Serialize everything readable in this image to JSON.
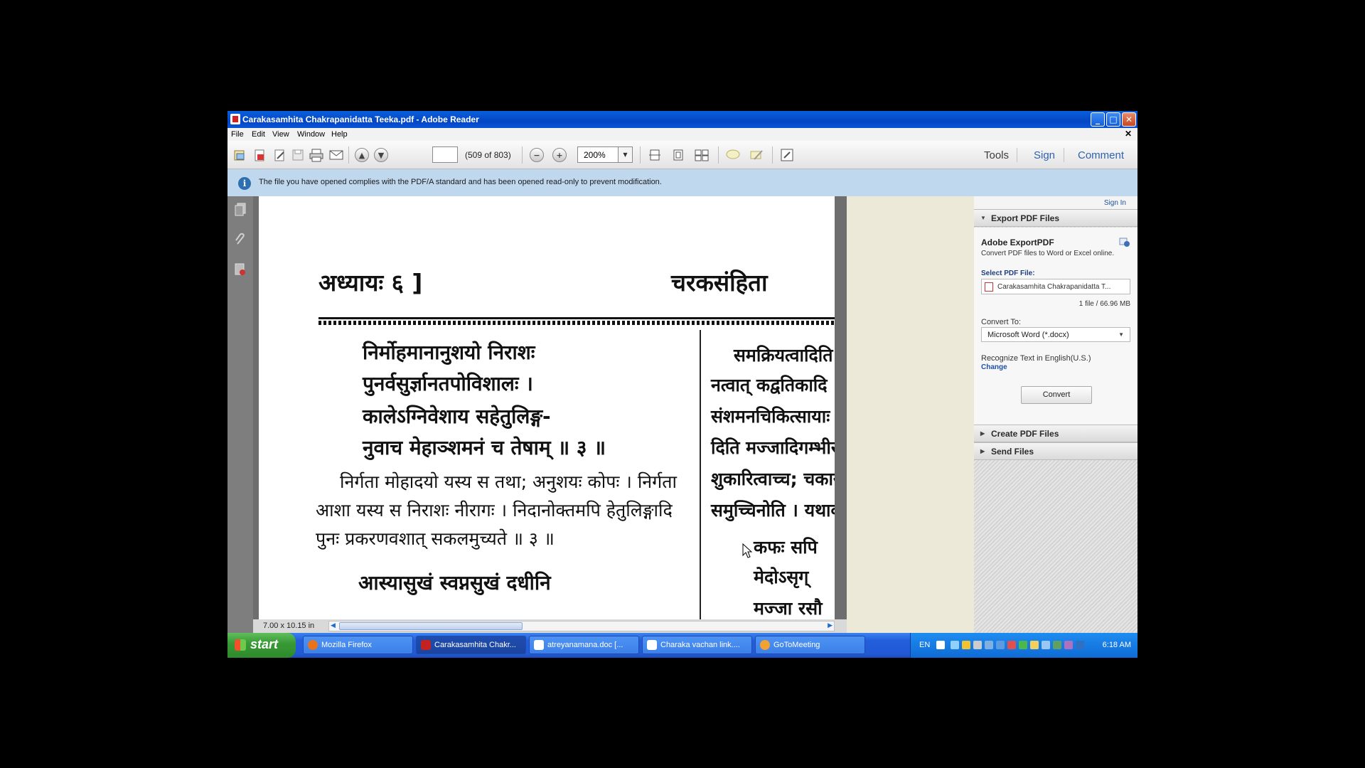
{
  "window": {
    "title": "Carakasamhita Chakrapanidatta Teeka.pdf - Adobe Reader",
    "minimize": "_",
    "maximize": "□",
    "close": "✕"
  },
  "menu": {
    "items": [
      "File",
      "Edit",
      "View",
      "Window",
      "Help"
    ],
    "doc_close": "✕"
  },
  "toolbar": {
    "page_input_value": "",
    "page_count": "(509 of 803)",
    "zoom": "200%",
    "tools_label": "Tools",
    "sign_label": "Sign",
    "comment_label": "Comment"
  },
  "infobar": {
    "icon": "i",
    "text": "The file you have opened complies with the PDF/A standard and has been opened read-only to prevent modification."
  },
  "document": {
    "header_left": "अध्यायः ६ ]",
    "header_right": "चरकसंहिता",
    "verse_lines": [
      "निर्मोहमानानुशयो निराशः",
      "पुनर्वसुर्ज्ञानतपोविशालः ।",
      "कालेऽग्निवेशाय सहेतुलिङ्ग-",
      "नुवाच मेहाञ्शमनं च तेषाम् ॥ ३ ॥"
    ],
    "commentary_lines": [
      "निर्गता मोहादयो यस्य स तथा;  अनुशयः कोपः । निर्गता",
      "आशा यस्य स निराशः  नीरागः । निदानोक्तमपि हेतुलिङ्गादि",
      "पुनः प्रकरणवशात् सकलमुच्यते ॥ ३ ॥"
    ],
    "next_verse": "आस्यासुखं स्वप्नसुखं दधीनि",
    "right_column_lines": [
      "समक्रियत्वादिति",
      "नत्वात्  कद्वतिकादि",
      "संशमनचिकित्सायाः",
      "दिति मज्जादिगम्भीर",
      "शुकारित्वाच्च;  चकार",
      "समुच्चिनोति । यथाक्",
      "कफः सपि",
      "मेदोऽसृग्",
      "मज्जा रसौ"
    ],
    "page_size": "7.00 x 10.15 in"
  },
  "right_panel": {
    "sign_in": "Sign In",
    "export_section": "Export PDF Files",
    "adobe_export_title": "Adobe ExportPDF",
    "adobe_export_desc": "Convert PDF files to Word or Excel online.",
    "select_label": "Select PDF File:",
    "file_name": "Carakasamhita Chakrapanidatta T...",
    "file_size": "1 file / 66.96 MB",
    "convert_to_label": "Convert To:",
    "convert_to_value": "Microsoft Word (*.docx)",
    "recognize_text": "Recognize Text in English(U.S.)",
    "change_link": "Change",
    "convert_button": "Convert",
    "create_section": "Create PDF Files",
    "send_section": "Send Files"
  },
  "taskbar": {
    "start": "start",
    "tasks": [
      {
        "label": "Mozilla Firefox",
        "icon": "firefox-icon",
        "color": "#E8731C"
      },
      {
        "label": "Carakasamhita Chakr...",
        "icon": "adobe-reader-icon",
        "color": "#C42121"
      },
      {
        "label": "atreyanamana.doc [...",
        "icon": "word-doc-icon",
        "color": "#FFFFFF"
      },
      {
        "label": "Charaka vachan link....",
        "icon": "word-doc-icon",
        "color": "#FFFFFF"
      },
      {
        "label": "GoToMeeting",
        "icon": "gotomeeting-icon",
        "color": "#F2A230"
      }
    ],
    "language": "EN",
    "clock": "6:18 AM"
  }
}
